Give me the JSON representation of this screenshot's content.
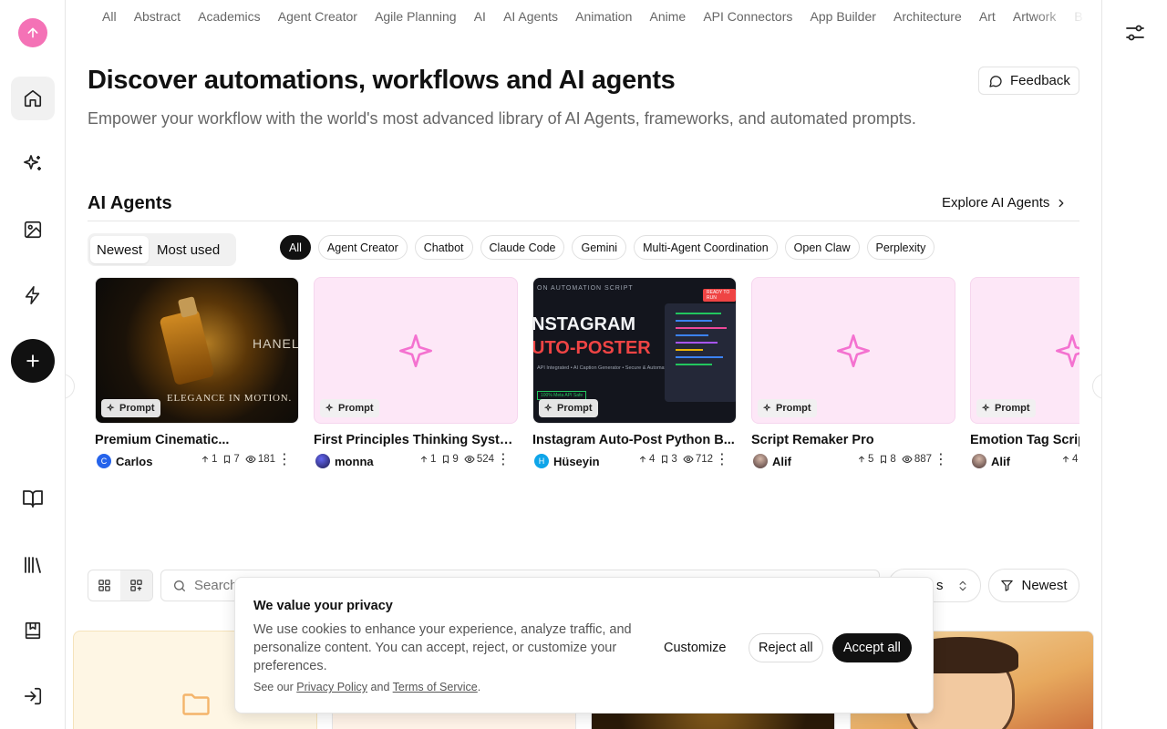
{
  "categories": [
    "All",
    "Abstract",
    "Academics",
    "Agent Creator",
    "Agile Planning",
    "AI",
    "AI Agents",
    "Animation",
    "Anime",
    "API Connectors",
    "App Builder",
    "Architecture",
    "Art",
    "Artwork",
    "B"
  ],
  "hero": {
    "title": "Discover automations, workflows and AI agents",
    "subtitle": "Empower your workflow with the world's most advanced library of AI Agents, frameworks, and automated prompts."
  },
  "feedback_label": "Feedback",
  "section": {
    "title": "AI Agents",
    "explore_label": "Explore AI Agents"
  },
  "sort_toggle": [
    "Newest",
    "Most used"
  ],
  "filter_chips": [
    "All",
    "Agent Creator",
    "Chatbot",
    "Claude Code",
    "Gemini",
    "Multi-Agent Coordination",
    "Open Claw",
    "Perplexity"
  ],
  "cards": [
    {
      "title": "Premium Cinematic...",
      "badge": "Prompt",
      "author": "Carlos",
      "avatar_letter": "C",
      "avatar_color": "#2563eb",
      "upvotes": "1",
      "saves": "7",
      "views": "181",
      "thumb": "perfume",
      "thumb_texts": [
        "HANEL",
        "ELEGANCE IN MOTION."
      ]
    },
    {
      "title": "First Principles Thinking System",
      "badge": "Prompt",
      "author": "monna",
      "avatar_letter": "",
      "avatar_color": "#4338ca",
      "upvotes": "1",
      "saves": "9",
      "views": "524",
      "thumb": "pink",
      "thumb_texts": []
    },
    {
      "title": "Instagram Auto-Post Python B...",
      "badge": "Prompt",
      "author": "Hüseyin",
      "avatar_letter": "H",
      "avatar_color": "#0ea5e9",
      "upvotes": "4",
      "saves": "3",
      "views": "712",
      "thumb": "insta",
      "thumb_texts": [
        "ON AUTOMATION SCRIPT",
        "NSTAGRAM",
        "UTO-POSTER",
        "API Integrated • AI Caption Generator • Secure & Automated",
        "100% Meta API Safe",
        "READY TO RUN"
      ]
    },
    {
      "title": "Script Remaker Pro",
      "badge": "Prompt",
      "author": "Alif",
      "avatar_letter": "",
      "avatar_color": "#6b4f4f",
      "upvotes": "5",
      "saves": "8",
      "views": "887",
      "thumb": "pink",
      "thumb_texts": []
    },
    {
      "title": "Emotion Tag Scrip",
      "badge": "Prompt",
      "author": "Alif",
      "avatar_letter": "",
      "avatar_color": "#6b4f4f",
      "upvotes": "4",
      "saves": "",
      "views": "",
      "thumb": "pink",
      "thumb_texts": []
    }
  ],
  "toolbar": {
    "search_placeholder": "Search",
    "select_value": "s",
    "newest_label": "Newest"
  },
  "cookie": {
    "title": "We value your privacy",
    "text": "We use cookies to enhance your experience, analyze traffic, and personalize content. You can accept, reject, or customize your preferences.",
    "links_prefix": "See our",
    "privacy_label": "Privacy Policy",
    "and_label": "and",
    "terms_label": "Terms of Service",
    "period": ".",
    "customize_label": "Customize",
    "reject_label": "Reject all",
    "accept_label": "Accept all"
  }
}
